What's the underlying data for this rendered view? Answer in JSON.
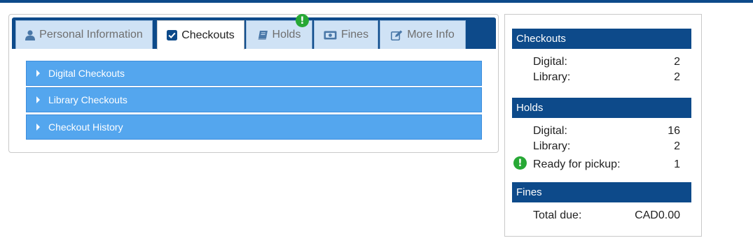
{
  "tabs": {
    "personal": "Personal Information",
    "checkouts": "Checkouts",
    "holds": "Holds",
    "fines": "Fines",
    "more": "More Info"
  },
  "alert_symbol": "!",
  "accordion": [
    {
      "label": "Digital Checkouts"
    },
    {
      "label": "Library Checkouts"
    },
    {
      "label": "Checkout History"
    }
  ],
  "summary": {
    "checkouts": {
      "title": "Checkouts",
      "digital_label": "Digital:",
      "digital_value": "2",
      "library_label": "Library:",
      "library_value": "2"
    },
    "holds": {
      "title": "Holds",
      "digital_label": "Digital:",
      "digital_value": "16",
      "library_label": "Library:",
      "library_value": "2",
      "ready_label": "Ready for pickup:",
      "ready_value": "1"
    },
    "fines": {
      "title": "Fines",
      "total_label": "Total due:",
      "total_value": "CAD0.00"
    }
  },
  "colors": {
    "brand": "#0d4a8a",
    "tab_inactive": "#cfe2f5",
    "accordion": "#54a6ee",
    "alert": "#27a835"
  },
  "icons": {
    "personal": "user-icon",
    "checkouts": "checkbox-icon",
    "holds": "book-icon",
    "fines": "money-icon",
    "more": "edit-icon",
    "alert": "exclamation-icon"
  }
}
